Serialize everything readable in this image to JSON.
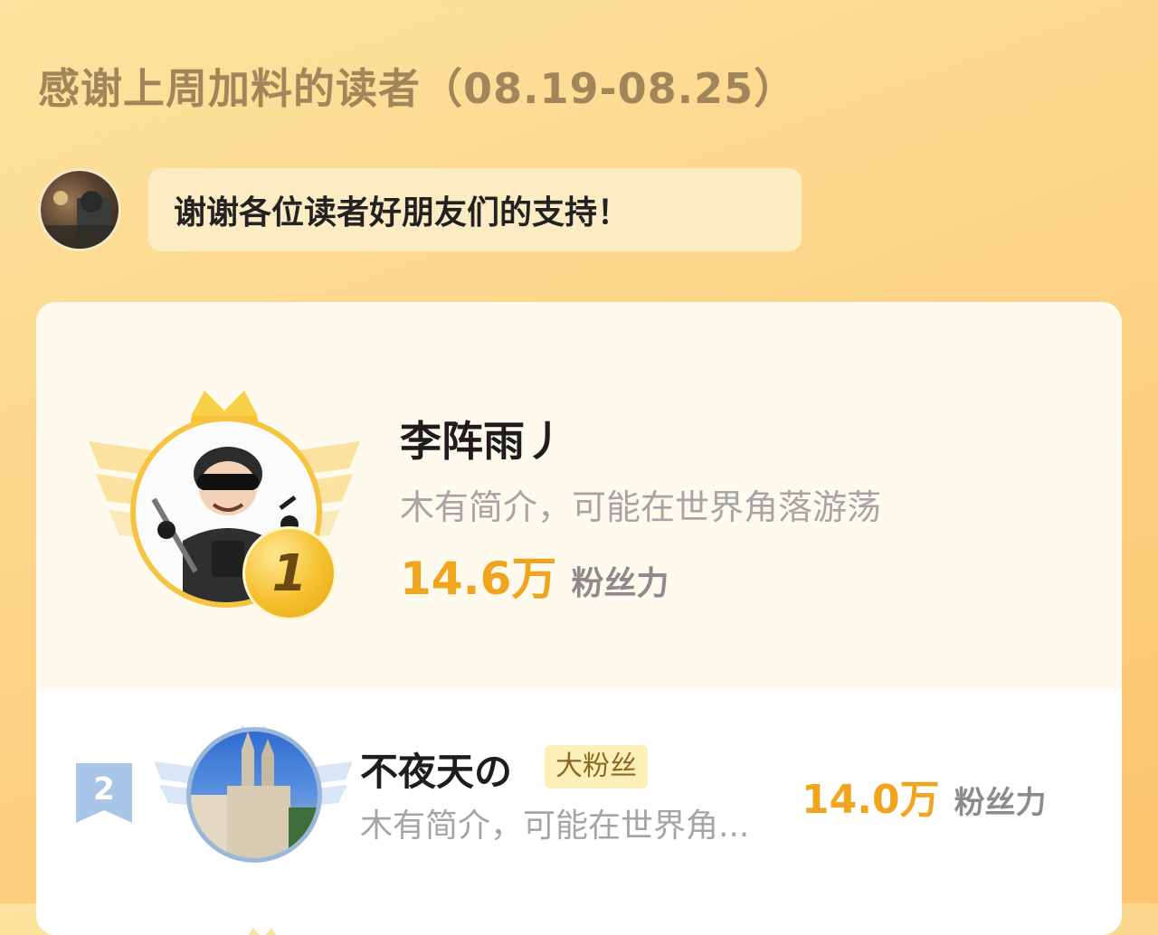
{
  "header": {
    "title": "感谢上周加料的读者（08.19-08.25）"
  },
  "message": {
    "text": "谢谢各位读者好朋友们的支持！"
  },
  "leaderboard": [
    {
      "rank": "1",
      "name": "李阵雨丿",
      "bio": "木有简介，可能在世界角落游荡",
      "fans_value": "14.6万",
      "fans_label": "粉丝力"
    },
    {
      "rank": "2",
      "name": "不夜天の",
      "badge": "大粉丝",
      "bio": "木有简介，可能在世界角...",
      "fans_value": "14.0万",
      "fans_label": "粉丝力"
    }
  ],
  "colors": {
    "accent_gold": "#f1a41d",
    "title_brown": "#a2855a",
    "gold_medal": "#f5c02d",
    "silver_badge": "#a9c6e8"
  },
  "icons": [
    "crown-icon",
    "wings-icon",
    "rank-medal-icon",
    "rank-badge-icon"
  ]
}
